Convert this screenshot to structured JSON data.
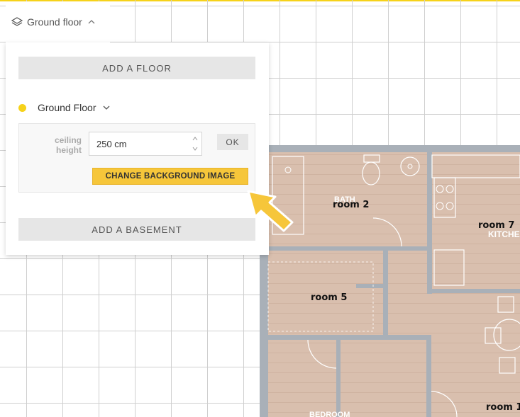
{
  "floor_selector": {
    "label": "Ground floor",
    "icon": "layers-icon"
  },
  "panel": {
    "add_floor_label": "ADD A FLOOR",
    "floor": {
      "name": "Ground Floor",
      "dot_color": "#f6d21a"
    },
    "ceiling": {
      "label_line1": "ceiling",
      "label_line2": "height",
      "value": "250 cm",
      "ok_label": "OK"
    },
    "change_background_label": "CHANGE BACKGROUND IMAGE",
    "add_basement_label": "ADD A BASEMENT"
  },
  "plan": {
    "rooms": [
      {
        "label": "room 2",
        "caption": "BATH"
      },
      {
        "label": "room 7",
        "caption": "KITCHEN"
      },
      {
        "label": "room 5",
        "caption": ""
      },
      {
        "label": "room 1",
        "caption": ""
      },
      {
        "label": "",
        "caption": "BEDROOM"
      }
    ]
  },
  "colors": {
    "accent": "#f6d21a",
    "button": "#f6c63a",
    "wall": "#a9b0b8",
    "floor_wood": "#d9bfae"
  }
}
